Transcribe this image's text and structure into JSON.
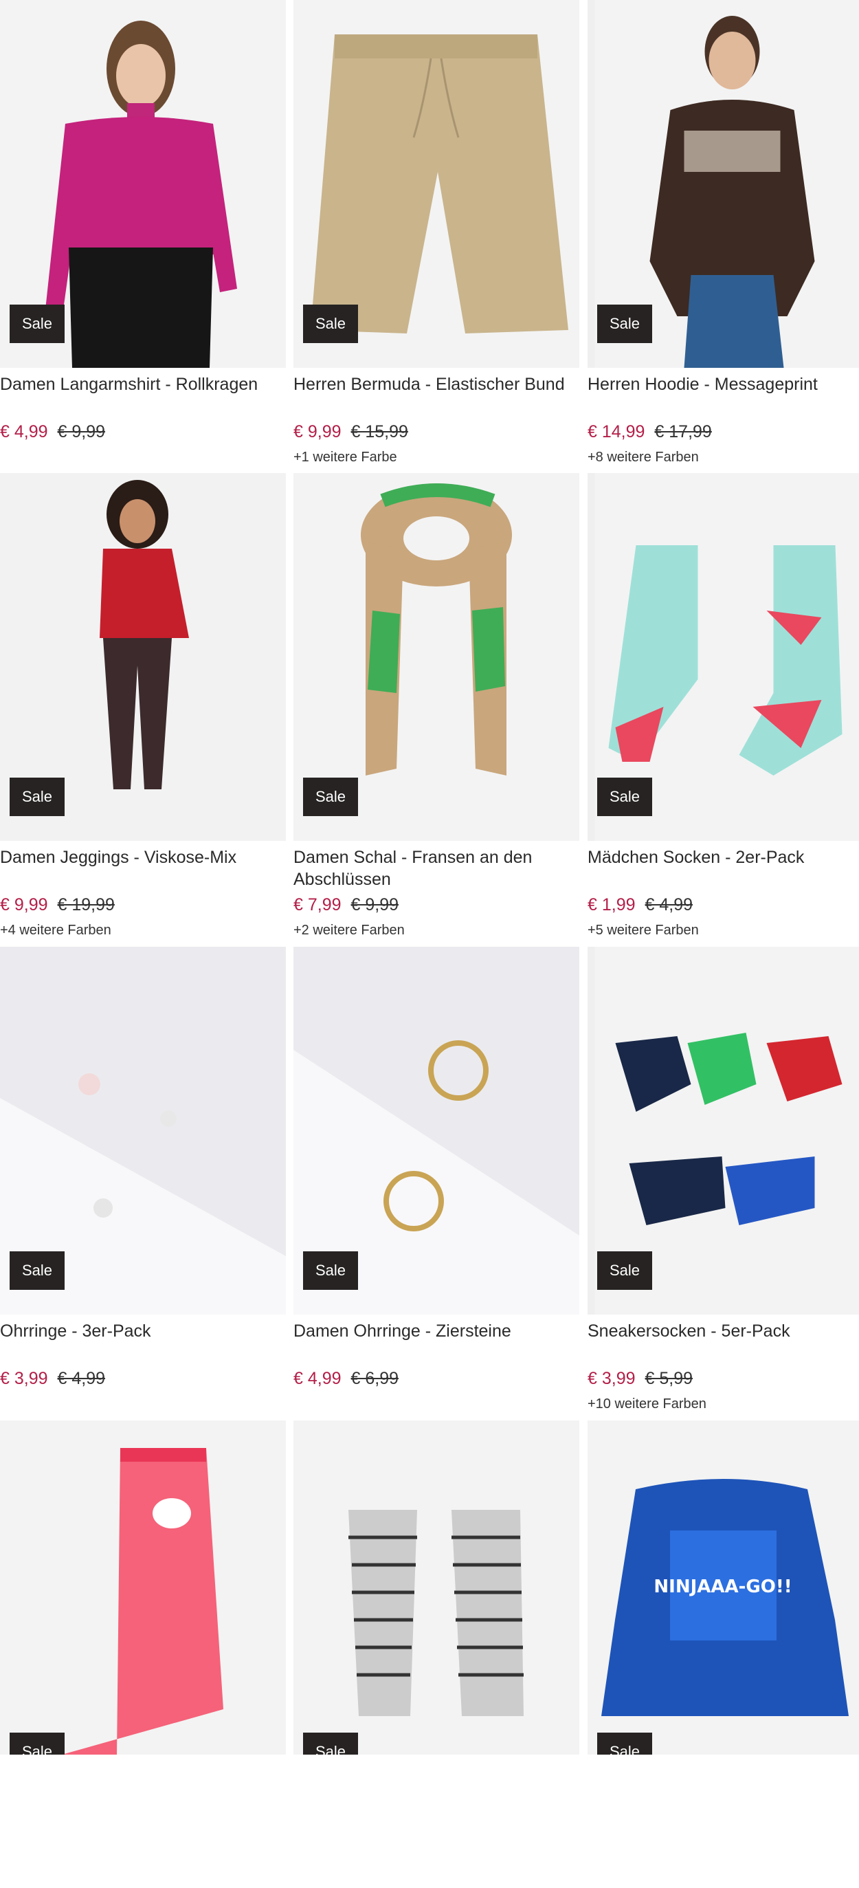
{
  "sale_label": "Sale",
  "products": [
    {
      "title": "Damen Langarmshirt - Rollkragen",
      "price": "€ 4,99",
      "old_price": "€ 9,99",
      "colors": ""
    },
    {
      "title": "Herren Bermuda - Elastischer Bund",
      "price": "€ 9,99",
      "old_price": "€ 15,99",
      "colors": "+1 weitere Farbe"
    },
    {
      "title": "Herren Hoodie - Messageprint",
      "price": "€ 14,99",
      "old_price": "€ 17,99",
      "colors": "+8 weitere Farben"
    },
    {
      "title": "Damen Jeggings - Viskose-Mix",
      "price": "€ 9,99",
      "old_price": "€ 19,99",
      "colors": "+4 weitere Farben"
    },
    {
      "title": "Damen Schal - Fransen an den Abschlüssen",
      "price": "€ 7,99",
      "old_price": "€ 9,99",
      "colors": "+2 weitere Farben"
    },
    {
      "title": "Mädchen Socken - 2er-Pack",
      "price": "€ 1,99",
      "old_price": "€ 4,99",
      "colors": "+5 weitere Farben"
    },
    {
      "title": "Ohrringe - 3er-Pack",
      "price": "€ 3,99",
      "old_price": "€ 4,99",
      "colors": ""
    },
    {
      "title": "Damen Ohrringe - Ziersteine",
      "price": "€ 4,99",
      "old_price": "€ 6,99",
      "colors": ""
    },
    {
      "title": "Sneakersocken - 5er-Pack",
      "price": "€ 3,99",
      "old_price": "€ 5,99",
      "colors": "+10 weitere Farben"
    }
  ]
}
